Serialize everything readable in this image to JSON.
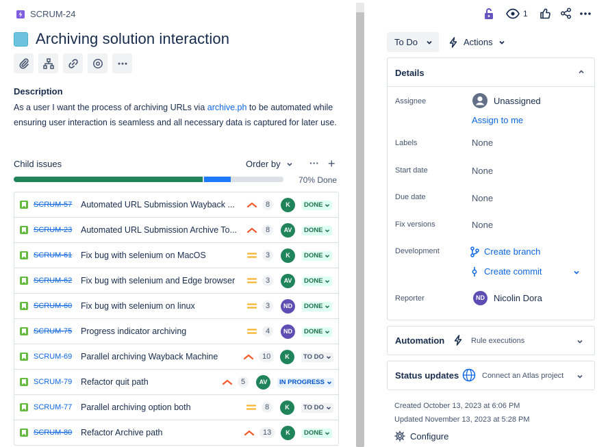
{
  "breadcrumb": {
    "key": "SCRUM-24",
    "icon": "lightning-icon"
  },
  "issue": {
    "title": "Archiving solution interaction",
    "description_label": "Description",
    "description_pre": "As a user I want the process of archiving URLs via ",
    "description_link": "archive.ph",
    "description_post": " to be automated while ensuring user interaction is seamless and all necessary data is captured for later use."
  },
  "toolbar": [
    "attachment-icon",
    "hierarchy-icon",
    "link-icon",
    "watch-icon",
    "more-icon"
  ],
  "child_issues": {
    "label": "Child issues",
    "order_by": "Order by",
    "progress_label": "70% Done",
    "progress": {
      "done": 0.7,
      "in_progress": 0.1
    },
    "items": [
      {
        "key": "SCRUM-57",
        "summary": "Automated URL Submission Wayback ...",
        "priority": "high",
        "estimate": "8",
        "assignee": "K",
        "status": "DONE",
        "strike": true
      },
      {
        "key": "SCRUM-23",
        "summary": "Automated URL Submission Archive To...",
        "priority": "high",
        "estimate": "8",
        "assignee": "AV",
        "status": "DONE",
        "strike": true
      },
      {
        "key": "SCRUM-61",
        "summary": "Fix bug with selenium on MacOS",
        "priority": "medium",
        "estimate": "3",
        "assignee": "K",
        "status": "DONE",
        "strike": true
      },
      {
        "key": "SCRUM-62",
        "summary": "Fix bug with selenium and Edge browser",
        "priority": "medium",
        "estimate": "3",
        "assignee": "AV",
        "status": "DONE",
        "strike": true
      },
      {
        "key": "SCRUM-60",
        "summary": "Fix bug with selenium on linux",
        "priority": "medium",
        "estimate": "3",
        "assignee": "ND",
        "status": "DONE",
        "strike": true
      },
      {
        "key": "SCRUM-75",
        "summary": "Progress indicator archiving",
        "priority": "medium",
        "estimate": "4",
        "assignee": "ND",
        "status": "DONE",
        "strike": true
      },
      {
        "key": "SCRUM-69",
        "summary": "Parallel archiving Wayback Machine",
        "priority": "high",
        "estimate": "10",
        "assignee": "K",
        "status": "TO DO",
        "strike": false
      },
      {
        "key": "SCRUM-79",
        "summary": "Refactor quit path",
        "priority": "high",
        "estimate": "5",
        "assignee": "AV",
        "status": "IN PROGRESS",
        "strike": false
      },
      {
        "key": "SCRUM-77",
        "summary": "Parallel archiving option both",
        "priority": "medium",
        "estimate": "8",
        "assignee": "K",
        "status": "TO DO",
        "strike": false
      },
      {
        "key": "SCRUM-80",
        "summary": "Refactor Archive path",
        "priority": "high",
        "estimate": "13",
        "assignee": "K",
        "status": "DONE",
        "strike": true
      }
    ]
  },
  "header_actions": {
    "watch_count": "1",
    "icons": [
      "lock-icon",
      "eye-icon",
      "thumbs-up-icon",
      "share-icon",
      "more-icon"
    ]
  },
  "status_button": "To Do",
  "actions_button": "Actions",
  "details": {
    "title": "Details",
    "assignee_label": "Assignee",
    "assignee_value": "Unassigned",
    "assign_to_me": "Assign to me",
    "labels_label": "Labels",
    "labels_value": "None",
    "start_label": "Start date",
    "start_value": "None",
    "due_label": "Due date",
    "due_value": "None",
    "fix_label": "Fix versions",
    "fix_value": "None",
    "dev_label": "Development",
    "create_branch": "Create branch",
    "create_commit": "Create commit",
    "reporter_label": "Reporter",
    "reporter_initials": "ND",
    "reporter_value": "Nicolin Dora"
  },
  "automation": {
    "title": "Automation",
    "sub": "Rule executions"
  },
  "status_updates": {
    "title": "Status updates",
    "sub": "Connect an Atlas project"
  },
  "meta": {
    "created": "Created October 13, 2023 at 6:06 PM",
    "updated": "Updated November 13, 2023 at 5:28 PM",
    "configure": "Configure"
  },
  "colors": {
    "avatar_K": "#1f845a",
    "avatar_AV": "#1f845a",
    "avatar_ND": "#5e4db2",
    "priority_high": "#f15b2a",
    "priority_medium": "#f8b32b"
  }
}
